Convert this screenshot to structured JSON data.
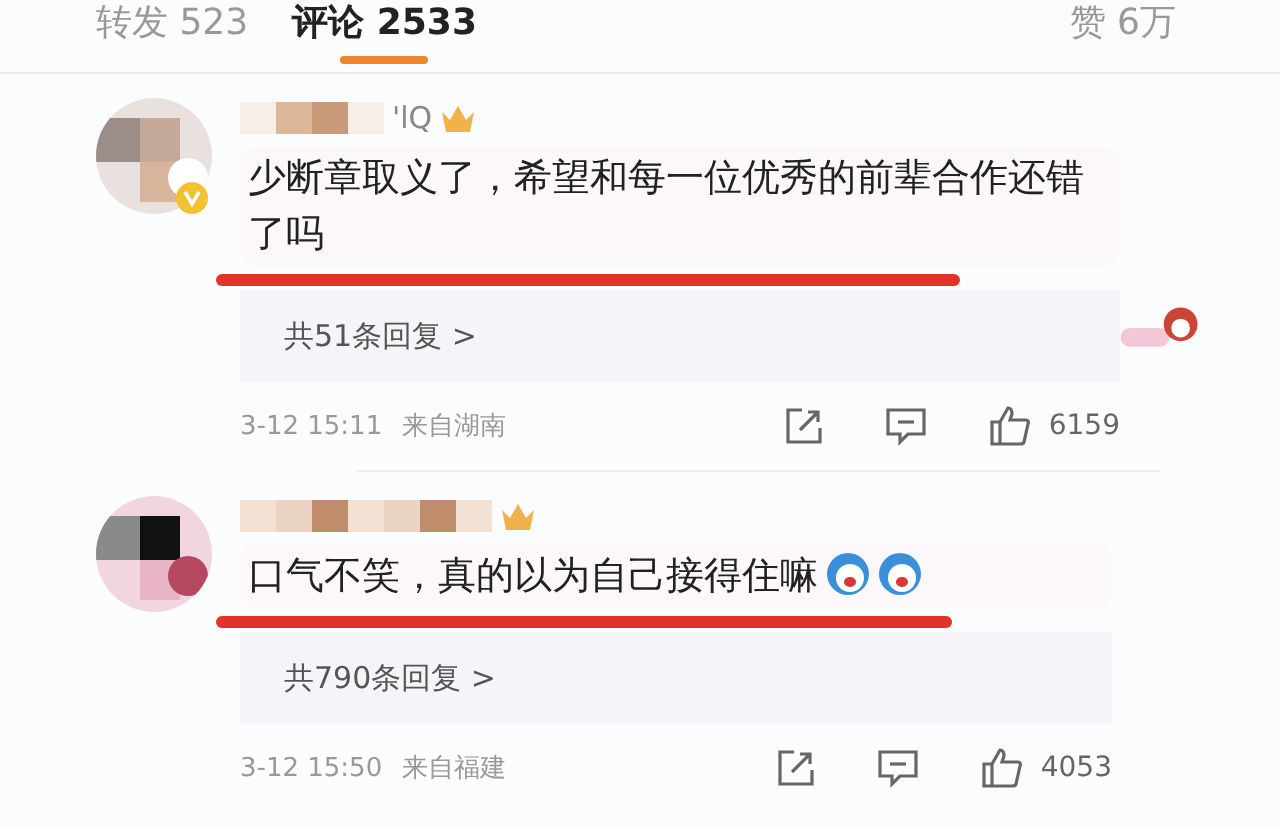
{
  "tabs": [
    {
      "label": "转发",
      "count": "523",
      "selected": false
    },
    {
      "label": "评论",
      "count": "2533",
      "selected": true
    },
    {
      "label": "赞",
      "count": "6万",
      "selected": false
    }
  ],
  "comments": [
    {
      "name_suffix": "'lQ",
      "verified": true,
      "text": "少断章取义了，希望和每一位优秀的前辈合作还错了吗",
      "sticker": true,
      "replies": "共51条回复 >",
      "time": "3-12 15:11",
      "location": "来自湖南",
      "likes": "6159"
    },
    {
      "verified": false,
      "text": "口气不笑，真的以为自己接得住嘛",
      "emojis": [
        {
          "kind": "face"
        },
        {
          "kind": "face"
        }
      ],
      "sticker": false,
      "replies": "共790条回复 >",
      "time": "3-12 15:50",
      "location": "来自福建",
      "likes": "4053"
    }
  ]
}
